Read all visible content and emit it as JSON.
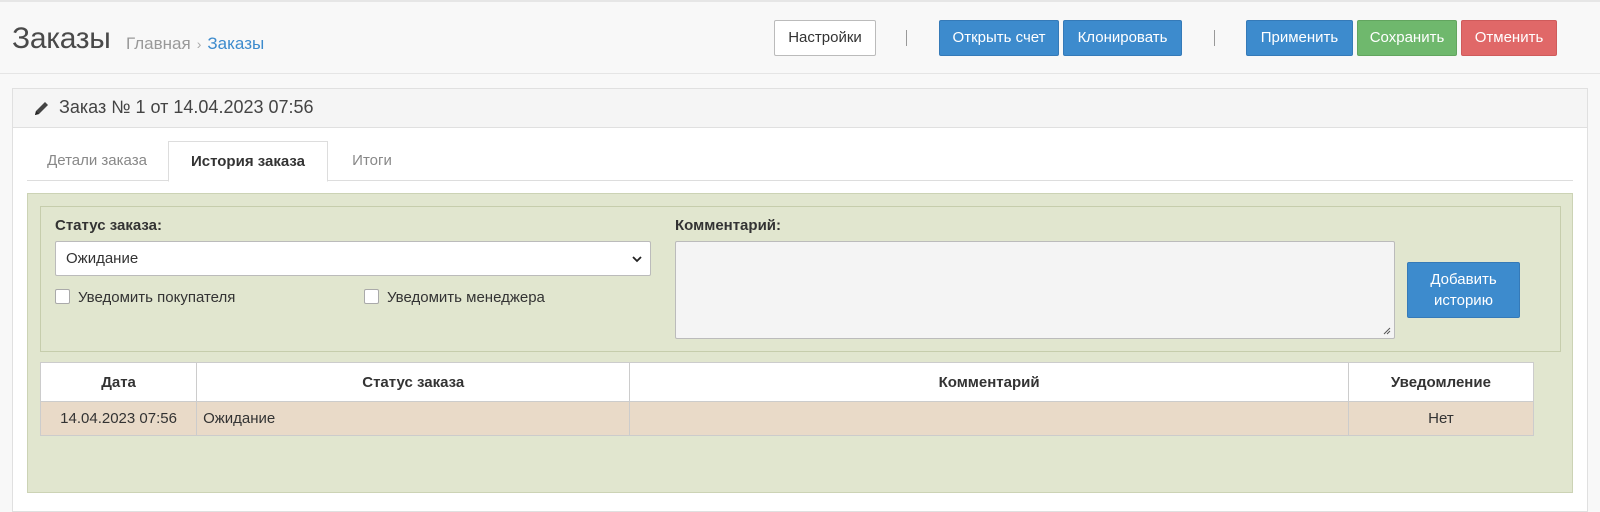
{
  "header": {
    "title": "Заказы",
    "breadcrumb": {
      "home": "Главная",
      "separator": "›",
      "current": "Заказы"
    },
    "buttons": {
      "settings": "Настройки",
      "open_invoice": "Открыть счет",
      "clone": "Клонировать",
      "apply": "Применить",
      "save": "Сохранить",
      "cancel": "Отменить"
    }
  },
  "panel": {
    "icon": "pencil-icon",
    "title": "Заказ № 1 от 14.04.2023 07:56"
  },
  "tabs": [
    {
      "label": "Детали заказа",
      "active": false
    },
    {
      "label": "История заказа",
      "active": true
    },
    {
      "label": "Итоги",
      "active": false
    }
  ],
  "form": {
    "status_label": "Статус заказа:",
    "status_value": "Ожидание",
    "notify_customer": {
      "label": "Уведомить покупателя",
      "checked": false
    },
    "notify_manager": {
      "label": "Уведомить менеджера",
      "checked": false
    },
    "comment_label": "Комментарий:",
    "comment_value": "",
    "add_history_button": "Добавить историю"
  },
  "history_table": {
    "columns": [
      "Дата",
      "Статус заказа",
      "Комментарий",
      "Уведомление"
    ],
    "rows": [
      {
        "date": "14.04.2023 07:56",
        "status": "Ожидание",
        "comment": "",
        "notify": "Нет"
      }
    ]
  },
  "colors": {
    "primary": "#3d8bcd",
    "success": "#6fb86d",
    "danger": "#e06868",
    "history_panel_bg": "#e1e6cf",
    "row_bg": "#e9dac8"
  }
}
